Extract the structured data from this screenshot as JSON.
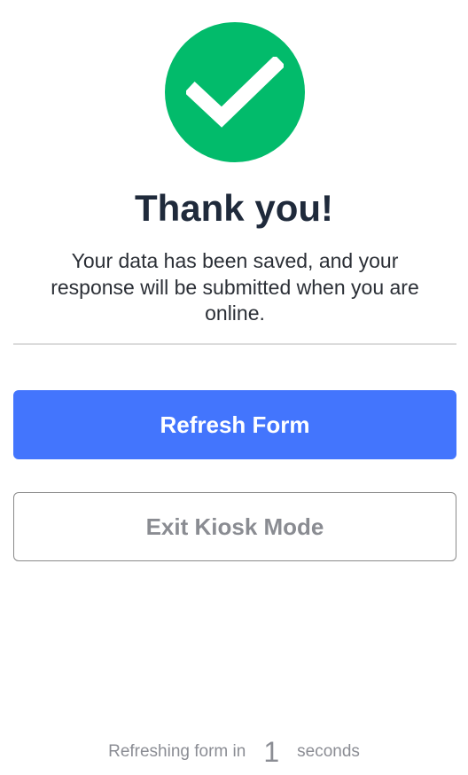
{
  "status": {
    "icon": "checkmark-icon",
    "title": "Thank you!",
    "message": "Your data has been saved, and your response will be submitted when you are online."
  },
  "actions": {
    "refresh_label": "Refresh Form",
    "exit_label": "Exit Kiosk Mode"
  },
  "countdown": {
    "prefix": "Refreshing form in",
    "value": "1",
    "suffix": "seconds"
  },
  "colors": {
    "success": "#02bb6b",
    "primary": "#4375fd",
    "title_text": "#1f2a3b",
    "muted_text": "#8b8d94"
  }
}
